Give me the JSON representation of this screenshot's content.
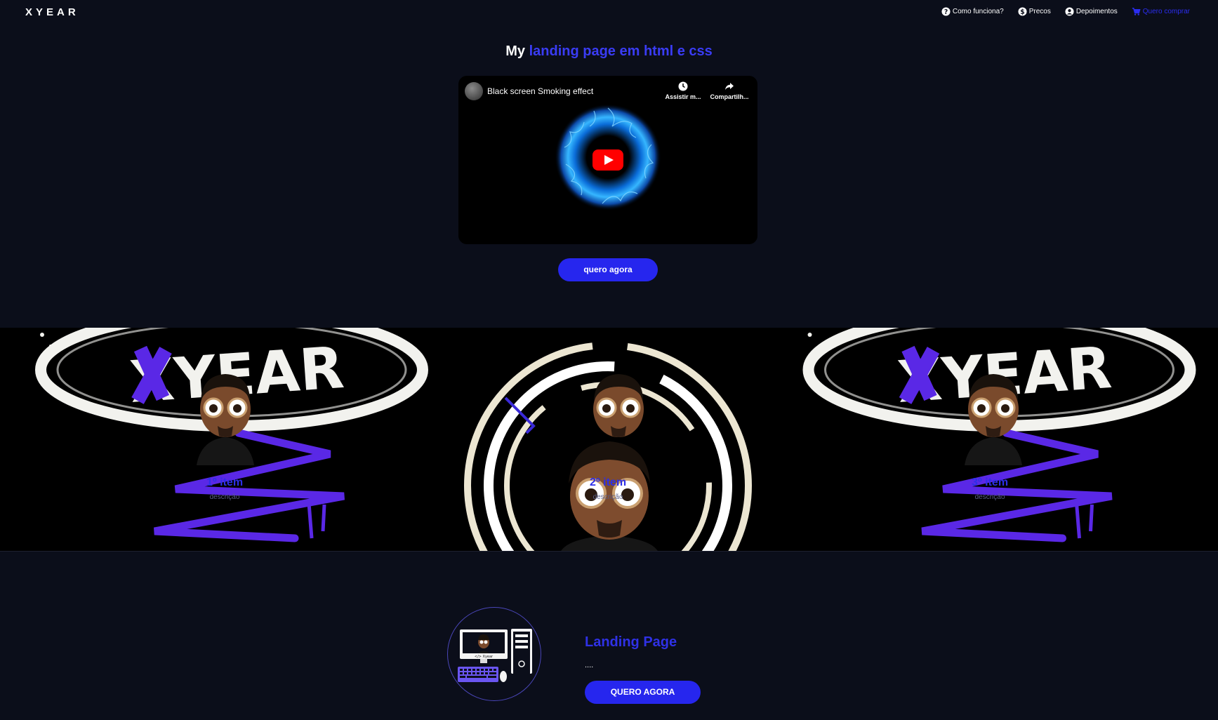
{
  "nav": {
    "logo": "XYEAR",
    "links": [
      {
        "label": "Como funciona?",
        "icon": "question-circle-icon"
      },
      {
        "label": "Precos",
        "icon": "dollar-circle-icon"
      },
      {
        "label": "Depoimentos",
        "icon": "user-circle-icon"
      },
      {
        "label": "Quero comprar",
        "icon": "cart-icon"
      }
    ]
  },
  "hero": {
    "title_prefix": "My",
    "title_accent": "landing page em html e css",
    "cta_label": "quero agora"
  },
  "video": {
    "title": "Black screen Smoking effect",
    "watch_later_label": "Assistir m...",
    "share_label": "Compartilh..."
  },
  "banner": {
    "art_text": "XYEAR",
    "items": [
      {
        "title": "1º item",
        "description": "descrição"
      },
      {
        "title": "2º item",
        "description": "descrição"
      },
      {
        "title": "3º item",
        "description": "descrição"
      }
    ]
  },
  "feature": {
    "title": "Landing Page",
    "text": "....",
    "cta_label": "QUERO AGORA",
    "monitor_caption": "</> Xyear"
  },
  "colors": {
    "background": "#0b0e1a",
    "accent": "#2626ee",
    "accent_text": "#3a3cf5",
    "banner_bg": "#000000",
    "youtube_red": "#ff0000"
  }
}
